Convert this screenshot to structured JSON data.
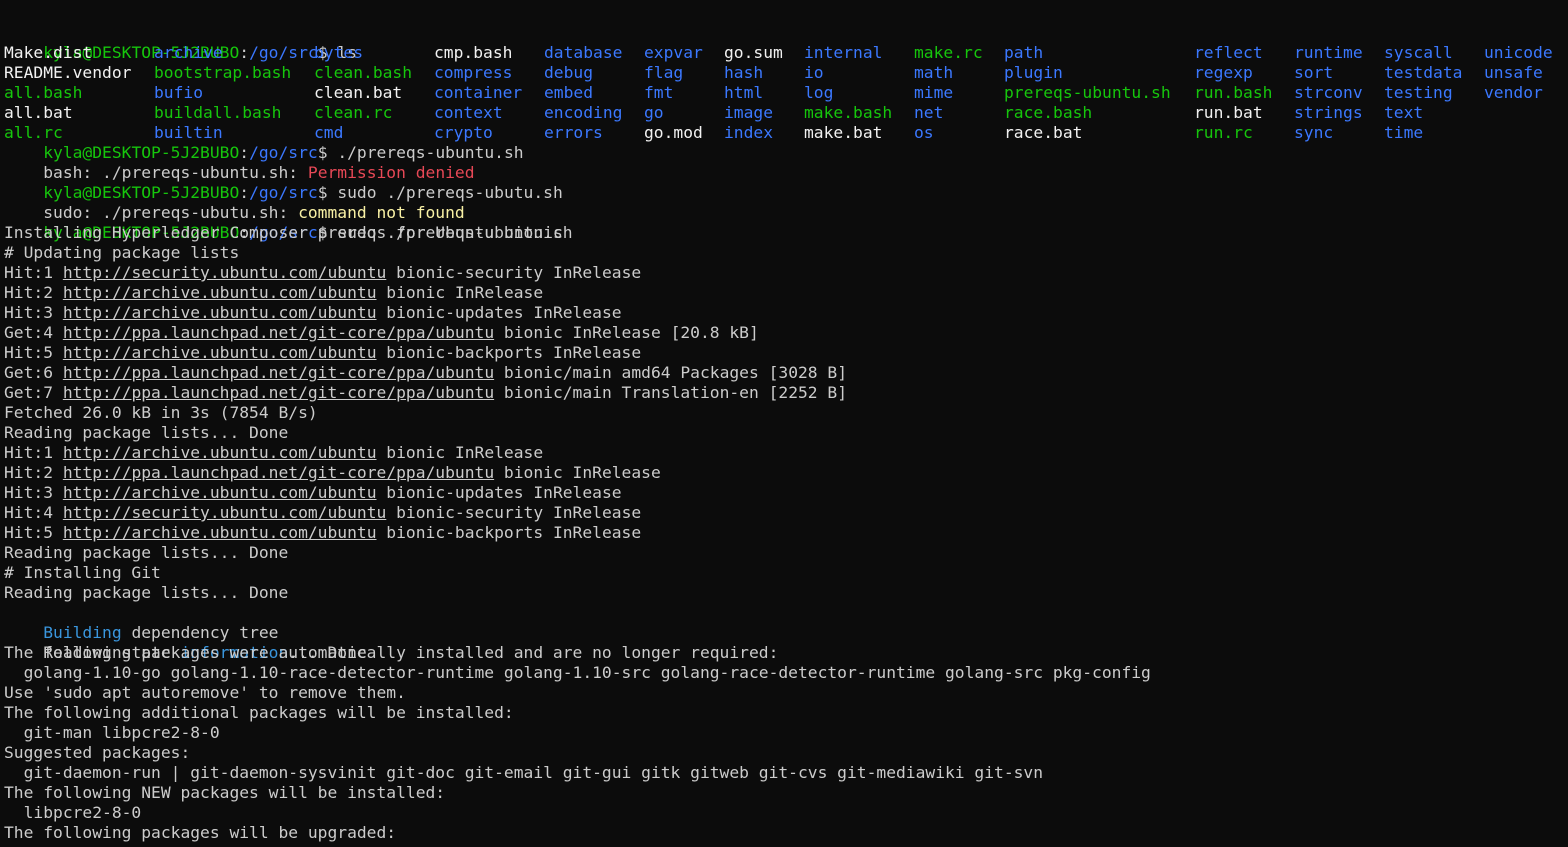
{
  "prompt": {
    "user_host": "kyla@DESKTOP-5J2BUBO",
    "sep": ":",
    "path": "/go/src",
    "symbol": "$ "
  },
  "ls_command": "ls",
  "ls_columns": [
    [
      "Make.dist",
      "README.vendor",
      "all.bash",
      "all.bat",
      "all.rc"
    ],
    [
      "archive",
      "bootstrap.bash",
      "bufio",
      "buildall.bash",
      "builtin"
    ],
    [
      "bytes",
      "clean.bash",
      "clean.bat",
      "clean.rc",
      "cmd"
    ],
    [
      "cmp.bash",
      "compress",
      "container",
      "context",
      "crypto"
    ],
    [
      "database",
      "debug",
      "embed",
      "encoding",
      "errors"
    ],
    [
      "expvar",
      "flag",
      "fmt",
      "go",
      "go.mod"
    ],
    [
      "go.sum",
      "hash",
      "html",
      "image",
      "index"
    ],
    [
      "internal",
      "io",
      "log",
      "make.bash",
      "make.bat"
    ],
    [
      "make.rc",
      "math",
      "mime",
      "net",
      "os"
    ],
    [
      "path",
      "plugin",
      "prereqs-ubuntu.sh",
      "race.bash",
      "race.bat"
    ],
    [
      "reflect",
      "regexp",
      "run.bash",
      "run.bat",
      "run.rc"
    ],
    [
      "runtime",
      "sort",
      "strconv",
      "strings",
      "sync"
    ],
    [
      "syscall",
      "testdata",
      "testing",
      "text",
      "time"
    ],
    [
      "unicode",
      "unsafe",
      "vendor",
      "",
      ""
    ]
  ],
  "cmd1": "./prereqs-ubuntu.sh",
  "err1": {
    "prefix": "bash: ./prereqs-ubuntu.sh: ",
    "msg": "Permission denied"
  },
  "cmd2": "sudo ./prereqs-ubutu.sh",
  "err2": {
    "prefix": "sudo: ./prereqs-ubutu.sh: ",
    "msg": "command not found"
  },
  "cmd3": "sudo ./prereqs-ubuntu.sh",
  "installing": "Installing Hyperledger Composer prereqs for Ubuntu bionic",
  "updating": "# Updating package lists",
  "apt1": [
    {
      "pre": "Hit:1 ",
      "url": "http://security.ubuntu.com/ubuntu",
      "post": " bionic-security InRelease"
    },
    {
      "pre": "Hit:2 ",
      "url": "http://archive.ubuntu.com/ubuntu",
      "post": " bionic InRelease"
    },
    {
      "pre": "Hit:3 ",
      "url": "http://archive.ubuntu.com/ubuntu",
      "post": " bionic-updates InRelease"
    },
    {
      "pre": "Get:4 ",
      "url": "http://ppa.launchpad.net/git-core/ppa/ubuntu",
      "post": " bionic InRelease [20.8 kB]"
    },
    {
      "pre": "Hit:5 ",
      "url": "http://archive.ubuntu.com/ubuntu",
      "post": " bionic-backports InRelease"
    },
    {
      "pre": "Get:6 ",
      "url": "http://ppa.launchpad.net/git-core/ppa/ubuntu",
      "post": " bionic/main amd64 Packages [3028 B]"
    },
    {
      "pre": "Get:7 ",
      "url": "http://ppa.launchpad.net/git-core/ppa/ubuntu",
      "post": " bionic/main Translation-en [2252 B]"
    }
  ],
  "fetched": "Fetched 26.0 kB in 3s (7854 B/s)",
  "reading1": "Reading package lists... Done",
  "apt2": [
    {
      "pre": "Hit:1 ",
      "url": "http://archive.ubuntu.com/ubuntu",
      "post": " bionic InRelease"
    },
    {
      "pre": "Hit:2 ",
      "url": "http://ppa.launchpad.net/git-core/ppa/ubuntu",
      "post": " bionic InRelease"
    },
    {
      "pre": "Hit:3 ",
      "url": "http://archive.ubuntu.com/ubuntu",
      "post": " bionic-updates InRelease"
    },
    {
      "pre": "Hit:4 ",
      "url": "http://security.ubuntu.com/ubuntu",
      "post": " bionic-security InRelease"
    },
    {
      "pre": "Hit:5 ",
      "url": "http://archive.ubuntu.com/ubuntu",
      "post": " bionic-backports InRelease"
    }
  ],
  "reading2": "Reading package lists... Done",
  "installing_git": "# Installing Git",
  "reading3": "Reading package lists... Done",
  "building": {
    "word": "Building",
    "rest": " dependency tree"
  },
  "reading_state": {
    "pre": "Reading state ",
    "word": "information",
    "post": "... Done"
  },
  "auto_installed": "The following packages were automatically installed and are no longer required:",
  "auto_list": "  golang-1.10-go golang-1.10-race-detector-runtime golang-1.10-src golang-race-detector-runtime golang-src pkg-config",
  "autoremove": "Use 'sudo apt autoremove' to remove them.",
  "additional": "The following additional packages will be installed:",
  "additional_list": "  git-man libpcre2-8-0",
  "suggested": "Suggested packages:",
  "suggested_list": "  git-daemon-run | git-daemon-sysvinit git-doc git-email git-gui gitk gitweb git-cvs git-mediawiki git-svn",
  "new_pkgs": "The following NEW packages will be installed:",
  "new_list": "  libpcre2-8-0",
  "upgraded": "The following packages will be upgraded:"
}
